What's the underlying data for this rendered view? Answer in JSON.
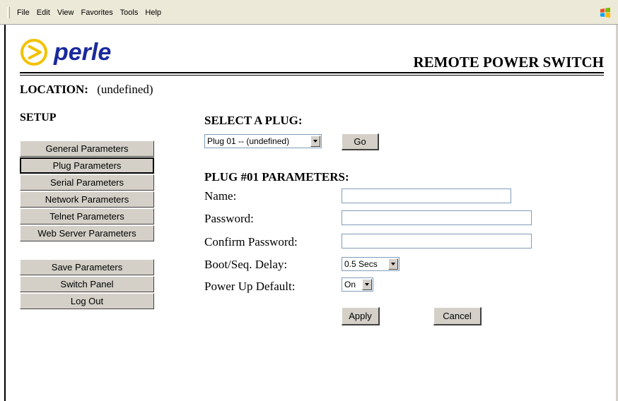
{
  "menubar": {
    "items": [
      "File",
      "Edit",
      "View",
      "Favorites",
      "Tools",
      "Help"
    ]
  },
  "header": {
    "logo_text": "perle",
    "product_title": "REMOTE POWER SWITCH"
  },
  "location": {
    "label": "LOCATION:",
    "value": "(undefined)"
  },
  "sidebar": {
    "title": "SETUP",
    "setup_items": [
      {
        "label": "General Parameters"
      },
      {
        "label": "Plug Parameters"
      },
      {
        "label": "Serial Parameters"
      },
      {
        "label": "Network Parameters"
      },
      {
        "label": "Telnet Parameters"
      },
      {
        "label": "Web Server Parameters"
      }
    ],
    "action_items": [
      {
        "label": "Save Parameters"
      },
      {
        "label": "Switch Panel"
      },
      {
        "label": "Log Out"
      }
    ]
  },
  "main": {
    "select_heading": "SELECT A PLUG:",
    "plug_select": "Plug 01 -- (undefined)",
    "go_label": "Go",
    "params_heading": "PLUG #01 PARAMETERS:",
    "fields": {
      "name": {
        "label": "Name:",
        "value": ""
      },
      "password": {
        "label": "Password:",
        "value": ""
      },
      "confirm": {
        "label": "Confirm Password:",
        "value": ""
      },
      "delay": {
        "label": "Boot/Seq. Delay:",
        "value": "0.5 Secs"
      },
      "powerup": {
        "label": "Power Up Default:",
        "value": "On"
      }
    },
    "apply_label": "Apply",
    "cancel_label": "Cancel"
  },
  "colors": {
    "brand_blue": "#1a2a9c",
    "logo_yellow": "#f2c200",
    "button_face": "#d4d0c8"
  }
}
